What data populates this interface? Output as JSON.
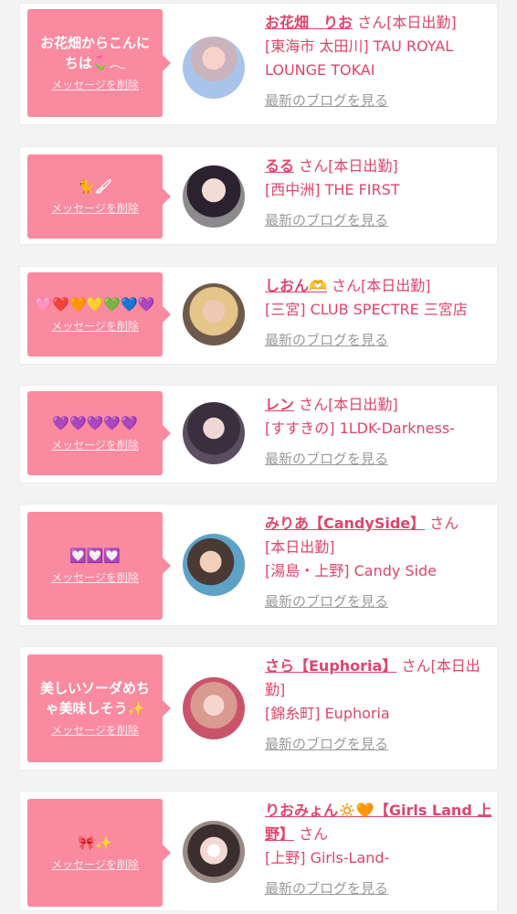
{
  "delete_label": "メッセージを削除",
  "blog_label": "最新のブログを見る",
  "cards": [
    {
      "message": "お花畑からこんにちは🌷𓂃",
      "name": "お花畑　りお",
      "san": "さん",
      "status": "[本日出勤]",
      "shop": "[東海市 太田川] TAU ROYAL LOUNGE TOKAI"
    },
    {
      "message": "🐈🖌",
      "name": "るる",
      "san": "さん",
      "status": "[本日出勤]",
      "shop": "[西中洲] THE FIRST"
    },
    {
      "message": "🩷❤️🧡💛💚💙💜",
      "name": "しおん🫶",
      "san": "さん",
      "status": "[本日出勤]",
      "shop": "[三宮] CLUB SPECTRE 三宮店"
    },
    {
      "message": "💜💜💜💜💜",
      "name": "レン",
      "san": "さん",
      "status": "[本日出勤]",
      "shop": "[すすきの] 1LDK-Darkness-"
    },
    {
      "message": "💟💟💟",
      "name": "みりあ【CandySide】",
      "san": "さん",
      "status": "[本日出勤]",
      "shop": "[湯島・上野] Candy Side"
    },
    {
      "message": "美しいソーダめちゃ美味しそう✨",
      "name": "さら【Euphoria】",
      "san": "さん",
      "status": "[本日出勤]",
      "shop": "[錦糸町] Euphoria"
    },
    {
      "message": "🎀✨",
      "name": "りおみょん🔅🧡【Girls Land 上野】",
      "san": "さん",
      "status": "",
      "shop": "[上野] Girls-Land-"
    }
  ],
  "colors": {
    "bubble": "#f98aa0",
    "accent": "#e0446a",
    "link_gray": "#9a9a9a"
  }
}
